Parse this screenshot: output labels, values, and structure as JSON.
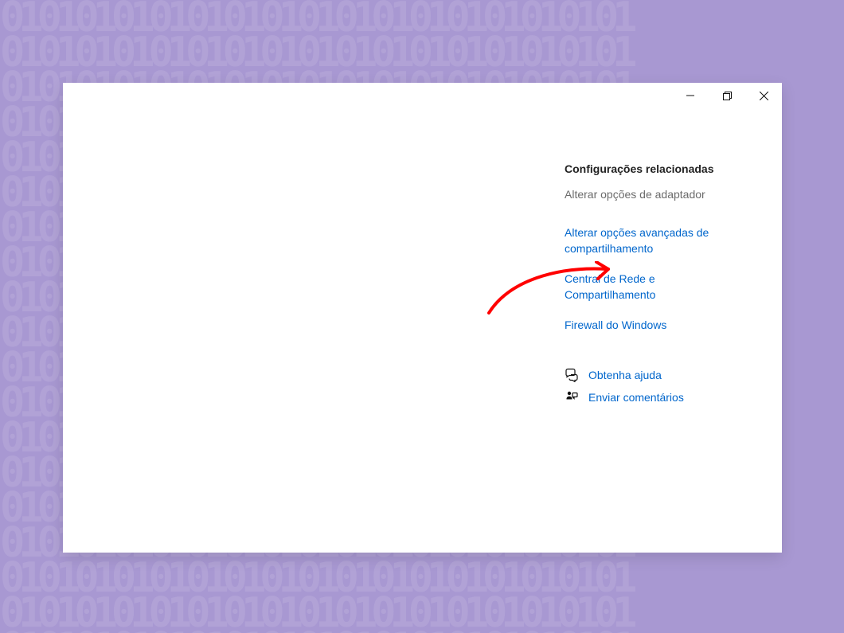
{
  "related": {
    "heading": "Configurações relacionadas",
    "adapter_options": "Alterar opções de adaptador",
    "advanced_sharing": "Alterar opções avançadas de compartilhamento",
    "network_sharing_center": "Central de Rede e Compartilhamento",
    "windows_firewall": "Firewall do Windows"
  },
  "footer": {
    "get_help": "Obtenha ajuda",
    "send_feedback": "Enviar comentários"
  },
  "window_controls": {
    "minimize": "Minimize",
    "maximize": "Maximize",
    "close": "Close"
  }
}
